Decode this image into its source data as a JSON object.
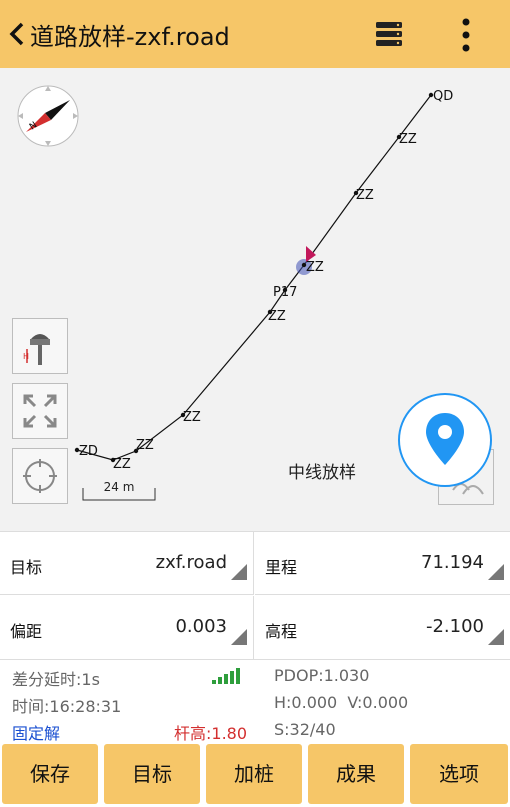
{
  "header": {
    "title": "道路放样-zxf.road",
    "back_icon": "chevron-left-icon",
    "list_icon": "list-icon",
    "more_icon": "more-vertical-icon"
  },
  "map": {
    "points": [
      {
        "label": "QD"
      },
      {
        "label": "ZZ"
      },
      {
        "label": "ZZ"
      },
      {
        "label": "ZZ"
      },
      {
        "label": "P17"
      },
      {
        "label": "ZZ"
      },
      {
        "label": "ZZ"
      },
      {
        "label": "ZZ"
      },
      {
        "label": "ZZ"
      },
      {
        "label": "ZD"
      }
    ],
    "scale_label": "24 m",
    "mode_label": "中线放样",
    "tools": [
      "receiver-height-icon",
      "zoom-extent-icon",
      "locate-icon"
    ],
    "nav_icon": "location-pin-icon",
    "speaker_icon": "voice-icon",
    "accent_color": "#2196f3"
  },
  "info": {
    "target_label": "目标",
    "target_value": "zxf.road",
    "mileage_label": "里程",
    "mileage_value": "71.194",
    "offset_label": "偏距",
    "offset_value": "0.003",
    "elevation_label": "高程",
    "elevation_value": "-2.100"
  },
  "status": {
    "diff_delay": "差分延时:1s",
    "time": "时间:16:28:31",
    "solution": "固定解",
    "pole_height": "杆高:1.80",
    "pdop": "PDOP:1.030",
    "hv": "H:0.000  V:0.000",
    "satellites": "S:32/40",
    "solution_color": "#1a4fd1",
    "pole_color": "#d32f2f",
    "signal_color": "#2e9e3c"
  },
  "actions": {
    "save": "保存",
    "target": "目标",
    "add_stake": "加桩",
    "results": "成果",
    "options": "选项",
    "bar_color": "#f6c668"
  }
}
